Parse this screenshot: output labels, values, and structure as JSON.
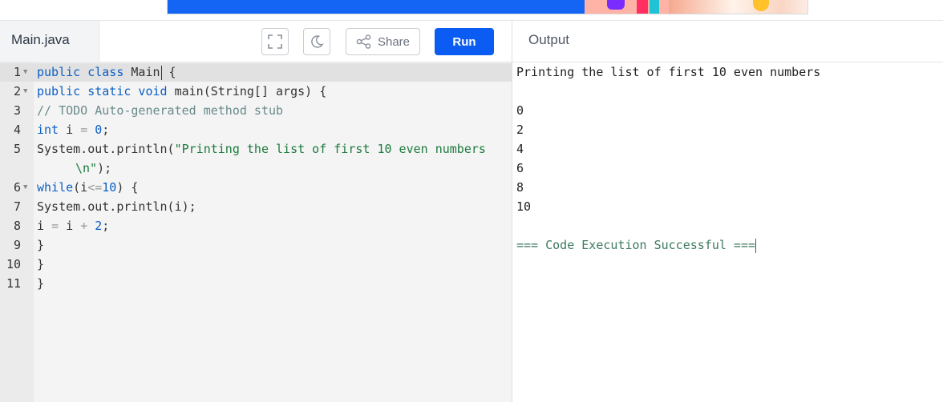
{
  "header": {
    "file_name": "Main.java",
    "share_label": "Share",
    "run_label": "Run",
    "output_title": "Output"
  },
  "icons": {
    "fullscreen": "fullscreen-icon",
    "theme": "moon-icon",
    "share": "share-icon",
    "fold": "fold-arrow-icon"
  },
  "colors": {
    "run_button": "#0b5cf2",
    "keyword": "#0b5fc4",
    "string": "#1c7a3e",
    "comment": "#6a8a8a",
    "success": "#3c7a5e"
  },
  "editor": {
    "line_numbers": [
      "1",
      "2",
      "3",
      "4",
      "5",
      "6",
      "7",
      "8",
      "9",
      "10",
      "11"
    ],
    "code": {
      "l1_kw": "public class",
      "l1_rest": " Main",
      "l1_end": " {",
      "l2_kw": "public static void",
      "l2_rest": " main(String[] args) {",
      "l3": "// TODO Auto-generated method stub",
      "l4_kw": "int",
      "l4_a": " i ",
      "l4_op": "=",
      "l4_sp": " ",
      "l4_num": "0",
      "l4_end": ";",
      "l5_a": "System.out.println(",
      "l5_str": "\"Printing the list of first 10 even numbers",
      "l5b_str": "\\n\"",
      "l5b_end": ");",
      "l6_kw": "while",
      "l6_a": "(i",
      "l6_op": "<=",
      "l6_num": "10",
      "l6_end": ") {",
      "l7": "System.out.println(i);",
      "l8_a": "i ",
      "l8_op1": "=",
      "l8_b": " i ",
      "l8_op2": "+",
      "l8_sp": " ",
      "l8_num": "2",
      "l8_end": ";",
      "l9": "}",
      "l10": "}",
      "l11": "}"
    }
  },
  "output": {
    "lines": [
      "Printing the list of first 10 even numbers",
      "",
      "0",
      "2",
      "4",
      "6",
      "8",
      "10",
      "",
      "=== Code Execution Successful ==="
    ]
  }
}
